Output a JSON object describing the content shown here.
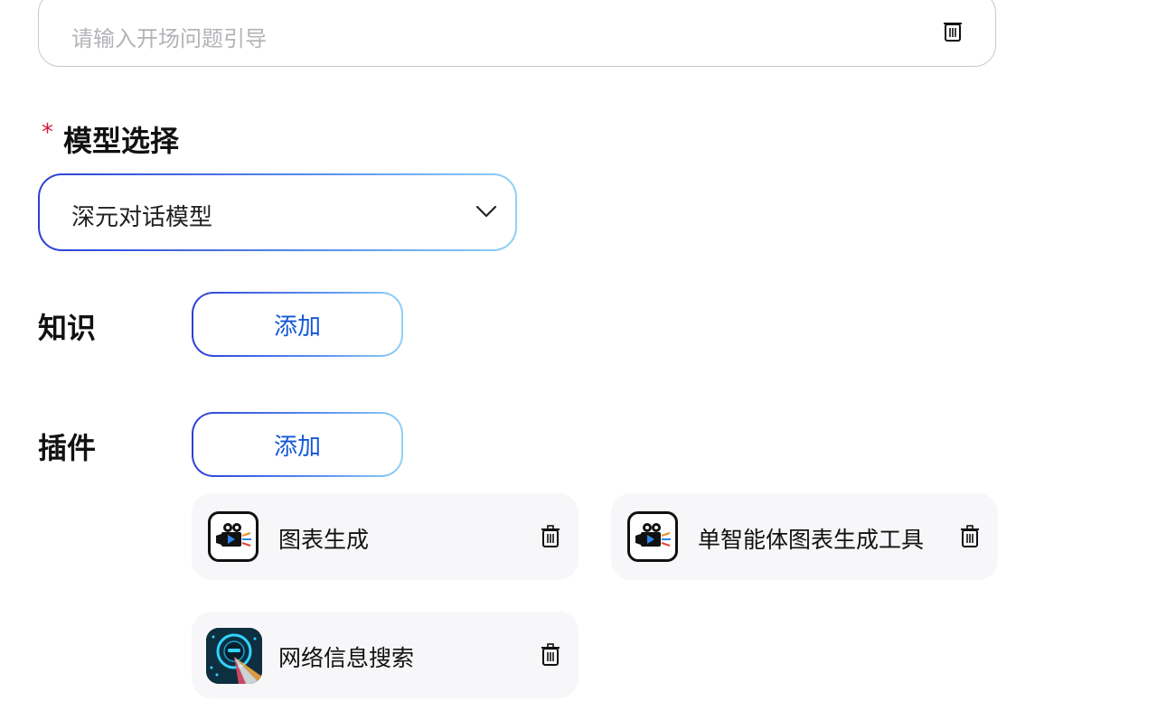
{
  "opening_question": {
    "placeholder": "请输入开场问题引导",
    "delete_icon": "trash-icon"
  },
  "model_section": {
    "required_mark": "*",
    "label": "模型选择",
    "selected_value": "深元对话模型",
    "dropdown_icon": "chevron-down-icon"
  },
  "knowledge_section": {
    "label": "知识",
    "add_label": "添加"
  },
  "plugin_section": {
    "label": "插件",
    "add_label": "添加",
    "plugins": [
      {
        "name": "图表生成",
        "icon": "video-camera-icon"
      },
      {
        "name": "单智能体图表生成工具",
        "icon": "video-camera-icon"
      },
      {
        "name": "网络信息搜索",
        "icon": "web-search-icon"
      }
    ]
  },
  "colors": {
    "accent_text": "#1457d9",
    "gradient_start": "#2b3fd8",
    "gradient_end": "#8fd2f5",
    "required": "#d21a3a",
    "card_bg": "#f7f7f9"
  }
}
